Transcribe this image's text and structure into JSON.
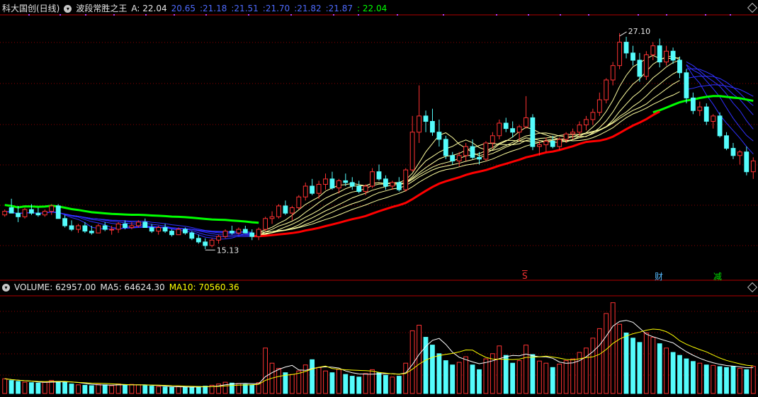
{
  "header": {
    "stock_title": "科大国创(日线)",
    "indicator_name": "波段常胜之王",
    "a_label": "A: 22.04",
    "ma_values": [
      "20.65",
      ":21.18",
      ":21.51",
      ":21.70",
      ":21.82",
      ":21.87",
      ": 22.04"
    ]
  },
  "volume_header": {
    "volume_label": "VOLUME: 62957.00",
    "ma5_label": "MA5: 64624.30",
    "ma10_label": "MA10: 70560.36"
  },
  "markers": {
    "s": "S",
    "cai": "财",
    "jian": "减"
  },
  "colors": {
    "up": "#ff3232",
    "down": "#54fcfc",
    "ma_red": "#ff0000",
    "ma_green": "#00ff00",
    "ribbon_yellow": "#ffffa0",
    "ribbon_blue": "#3030ff",
    "volume_ma5": "#ffffff",
    "volume_ma10": "#ffff00",
    "grid": "#8b0000"
  },
  "chart_data": [
    {
      "type": "candlestick",
      "title": "波段常胜之王",
      "annotations": [
        {
          "label": "15.13",
          "value": 15.13
        },
        {
          "label": "27.10",
          "value": 27.1
        }
      ],
      "ylim": [
        14.0,
        28.0
      ],
      "candles": [
        [
          17.0,
          17.3,
          16.9,
          17.2
        ],
        [
          17.4,
          17.9,
          17.1,
          17.1
        ],
        [
          17.1,
          17.5,
          16.6,
          16.9
        ],
        [
          16.9,
          17.4,
          16.8,
          17.3
        ],
        [
          17.3,
          17.6,
          17.0,
          17.1
        ],
        [
          17.1,
          17.4,
          16.9,
          17.0
        ],
        [
          17.0,
          17.3,
          16.9,
          17.2
        ],
        [
          17.2,
          17.6,
          17.0,
          17.5
        ],
        [
          17.5,
          17.6,
          16.8,
          16.8
        ],
        [
          16.8,
          17.0,
          16.3,
          16.4
        ],
        [
          16.4,
          16.7,
          16.1,
          16.2
        ],
        [
          16.2,
          16.5,
          16.0,
          16.4
        ],
        [
          16.4,
          16.6,
          16.0,
          16.1
        ],
        [
          16.1,
          16.4,
          15.9,
          16.0
        ],
        [
          16.0,
          16.5,
          16.0,
          16.4
        ],
        [
          16.4,
          16.6,
          16.1,
          16.2
        ],
        [
          16.2,
          16.4,
          15.9,
          16.2
        ],
        [
          16.2,
          16.6,
          16.0,
          16.5
        ],
        [
          16.5,
          16.7,
          16.2,
          16.3
        ],
        [
          16.3,
          16.6,
          16.2,
          16.4
        ],
        [
          16.4,
          16.7,
          16.3,
          16.6
        ],
        [
          16.6,
          16.8,
          16.3,
          16.3
        ],
        [
          16.3,
          16.5,
          16.0,
          16.1
        ],
        [
          16.1,
          16.4,
          15.9,
          16.3
        ],
        [
          16.3,
          16.5,
          16.0,
          16.1
        ],
        [
          16.1,
          16.2,
          15.8,
          15.9
        ],
        [
          15.9,
          16.3,
          15.9,
          16.2
        ],
        [
          16.2,
          16.3,
          15.9,
          16.0
        ],
        [
          16.0,
          16.1,
          15.6,
          15.7
        ],
        [
          15.7,
          15.9,
          15.4,
          15.5
        ],
        [
          15.5,
          15.7,
          15.1,
          15.3
        ],
        [
          15.3,
          15.7,
          15.2,
          15.6
        ],
        [
          15.6,
          15.9,
          15.4,
          15.8
        ],
        [
          15.8,
          16.2,
          15.7,
          16.1
        ],
        [
          16.1,
          16.4,
          15.9,
          16.0
        ],
        [
          16.0,
          16.3,
          15.9,
          16.2
        ],
        [
          16.2,
          16.4,
          16.0,
          16.0
        ],
        [
          16.0,
          16.2,
          15.6,
          15.8
        ],
        [
          15.8,
          16.3,
          15.6,
          16.2
        ],
        [
          16.2,
          16.9,
          16.1,
          16.8
        ],
        [
          16.8,
          17.2,
          16.5,
          16.9
        ],
        [
          16.9,
          17.6,
          16.8,
          17.5
        ],
        [
          17.5,
          17.8,
          17.0,
          17.1
        ],
        [
          17.1,
          17.5,
          16.7,
          17.4
        ],
        [
          17.4,
          18.1,
          17.3,
          18.0
        ],
        [
          18.0,
          18.8,
          17.8,
          18.6
        ],
        [
          18.6,
          19.0,
          18.1,
          18.2
        ],
        [
          18.2,
          18.9,
          17.9,
          18.7
        ],
        [
          18.7,
          19.3,
          18.4,
          19.0
        ],
        [
          19.0,
          19.4,
          18.4,
          18.5
        ],
        [
          18.5,
          19.0,
          18.2,
          18.9
        ],
        [
          18.9,
          19.3,
          18.6,
          18.8
        ],
        [
          18.8,
          19.1,
          18.4,
          18.6
        ],
        [
          18.6,
          18.9,
          18.2,
          18.3
        ],
        [
          18.3,
          18.7,
          18.1,
          18.6
        ],
        [
          18.6,
          19.6,
          18.5,
          19.4
        ],
        [
          19.4,
          19.8,
          18.9,
          19.0
        ],
        [
          19.0,
          19.2,
          18.4,
          18.6
        ],
        [
          18.6,
          18.9,
          18.4,
          18.8
        ],
        [
          18.8,
          19.1,
          18.3,
          18.4
        ],
        [
          18.4,
          19.6,
          18.3,
          19.5
        ],
        [
          19.5,
          22.5,
          19.4,
          21.6
        ],
        [
          21.6,
          24.2,
          21.0,
          22.5
        ],
        [
          22.5,
          22.8,
          21.6,
          22.2
        ],
        [
          22.2,
          22.9,
          21.4,
          21.6
        ],
        [
          21.6,
          22.3,
          20.8,
          21.2
        ],
        [
          21.2,
          21.4,
          20.1,
          20.3
        ],
        [
          20.3,
          20.5,
          19.8,
          20.0
        ],
        [
          20.0,
          20.5,
          19.7,
          20.3
        ],
        [
          20.3,
          21.0,
          20.0,
          20.8
        ],
        [
          20.8,
          21.2,
          20.1,
          20.2
        ],
        [
          20.2,
          20.5,
          19.8,
          20.1
        ],
        [
          20.1,
          21.1,
          20.0,
          21.0
        ],
        [
          21.0,
          21.6,
          20.7,
          21.4
        ],
        [
          21.4,
          22.3,
          21.2,
          22.1
        ],
        [
          22.1,
          22.4,
          21.6,
          21.8
        ],
        [
          21.8,
          22.2,
          21.3,
          21.6
        ],
        [
          21.6,
          22.0,
          21.1,
          21.9
        ],
        [
          21.9,
          23.6,
          21.8,
          22.4
        ],
        [
          22.4,
          22.6,
          20.6,
          20.8
        ],
        [
          20.8,
          21.1,
          20.3,
          20.9
        ],
        [
          20.9,
          21.3,
          20.5,
          21.1
        ],
        [
          21.1,
          21.4,
          20.7,
          20.8
        ],
        [
          20.8,
          21.3,
          20.6,
          21.2
        ],
        [
          21.2,
          21.6,
          21.0,
          21.5
        ],
        [
          21.5,
          21.8,
          21.2,
          21.6
        ],
        [
          21.6,
          22.2,
          21.4,
          22.0
        ],
        [
          22.0,
          22.5,
          21.7,
          22.3
        ],
        [
          22.3,
          22.9,
          22.0,
          22.7
        ],
        [
          22.7,
          23.8,
          22.5,
          23.4
        ],
        [
          23.4,
          24.6,
          23.2,
          24.5
        ],
        [
          24.5,
          25.5,
          24.2,
          25.3
        ],
        [
          25.3,
          27.1,
          25.1,
          26.6
        ],
        [
          26.6,
          26.9,
          25.7,
          26.0
        ],
        [
          26.0,
          26.4,
          25.3,
          25.6
        ],
        [
          25.6,
          26.0,
          24.4,
          24.7
        ],
        [
          24.7,
          26.1,
          24.5,
          25.9
        ],
        [
          25.9,
          26.6,
          25.6,
          26.4
        ],
        [
          26.4,
          26.8,
          25.2,
          25.5
        ],
        [
          25.5,
          26.4,
          25.3,
          26.1
        ],
        [
          26.1,
          26.3,
          25.4,
          25.6
        ],
        [
          25.6,
          25.8,
          24.6,
          24.9
        ],
        [
          24.9,
          25.1,
          23.2,
          23.5
        ],
        [
          23.5,
          23.8,
          22.6,
          22.8
        ],
        [
          22.8,
          23.3,
          22.5,
          23.0
        ],
        [
          23.0,
          23.2,
          22.0,
          22.2
        ],
        [
          22.2,
          22.6,
          21.8,
          22.5
        ],
        [
          22.5,
          22.7,
          21.3,
          21.4
        ],
        [
          21.4,
          21.6,
          20.6,
          20.7
        ],
        [
          20.7,
          21.0,
          20.1,
          20.3
        ],
        [
          20.3,
          20.6,
          19.8,
          20.5
        ],
        [
          20.5,
          20.8,
          19.2,
          19.4
        ],
        [
          19.4,
          20.2,
          19.0,
          20.0
        ]
      ]
    },
    {
      "type": "bar",
      "title": "VOLUME",
      "volume": [
        34,
        30,
        28,
        26,
        25,
        24,
        26,
        30,
        28,
        27,
        22,
        20,
        19,
        18,
        21,
        20,
        18,
        22,
        19,
        21,
        20,
        18,
        17,
        16,
        15,
        14,
        16,
        15,
        14,
        16,
        17,
        19,
        22,
        26,
        24,
        23,
        21,
        20,
        25,
        105,
        70,
        58,
        48,
        44,
        52,
        66,
        78,
        60,
        52,
        48,
        56,
        44,
        40,
        38,
        46,
        55,
        48,
        42,
        38,
        40,
        70,
        145,
        158,
        130,
        112,
        92,
        76,
        66,
        72,
        85,
        66,
        55,
        80,
        92,
        110,
        88,
        70,
        76,
        112,
        90,
        75,
        70,
        60,
        68,
        76,
        80,
        95,
        105,
        128,
        150,
        185,
        210,
        160,
        140,
        128,
        118,
        140,
        130,
        115,
        105,
        95,
        88,
        80,
        74,
        70,
        66,
        65,
        62,
        60,
        63,
        58,
        55,
        63
      ]
    }
  ]
}
